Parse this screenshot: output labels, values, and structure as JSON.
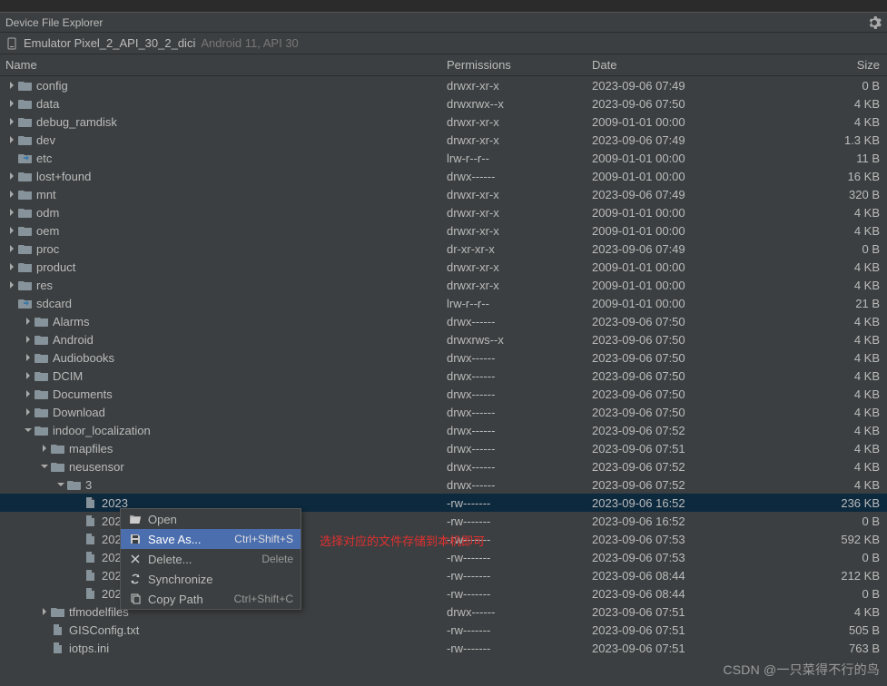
{
  "panel": {
    "title": "Device File Explorer"
  },
  "device": {
    "name": "Emulator Pixel_2_API_30_2_dici",
    "sub": "Android 11, API 30"
  },
  "columns": {
    "name": "Name",
    "perm": "Permissions",
    "date": "Date",
    "size": "Size"
  },
  "rows": [
    {
      "indent": 0,
      "arrow": "r",
      "icon": "folder",
      "name": "config",
      "perm": "drwxr-xr-x",
      "date": "2023-09-06 07:49",
      "size": "0 B"
    },
    {
      "indent": 0,
      "arrow": "r",
      "icon": "folder",
      "name": "data",
      "perm": "drwxrwx--x",
      "date": "2023-09-06 07:50",
      "size": "4 KB"
    },
    {
      "indent": 0,
      "arrow": "r",
      "icon": "folder",
      "name": "debug_ramdisk",
      "perm": "drwxr-xr-x",
      "date": "2009-01-01 00:00",
      "size": "4 KB"
    },
    {
      "indent": 0,
      "arrow": "r",
      "icon": "folder",
      "name": "dev",
      "perm": "drwxr-xr-x",
      "date": "2023-09-06 07:49",
      "size": "1.3 KB"
    },
    {
      "indent": 0,
      "arrow": "",
      "icon": "folder-link",
      "name": "etc",
      "perm": "lrw-r--r--",
      "date": "2009-01-01 00:00",
      "size": "11 B"
    },
    {
      "indent": 0,
      "arrow": "r",
      "icon": "folder",
      "name": "lost+found",
      "perm": "drwx------",
      "date": "2009-01-01 00:00",
      "size": "16 KB"
    },
    {
      "indent": 0,
      "arrow": "r",
      "icon": "folder",
      "name": "mnt",
      "perm": "drwxr-xr-x",
      "date": "2023-09-06 07:49",
      "size": "320 B"
    },
    {
      "indent": 0,
      "arrow": "r",
      "icon": "folder",
      "name": "odm",
      "perm": "drwxr-xr-x",
      "date": "2009-01-01 00:00",
      "size": "4 KB"
    },
    {
      "indent": 0,
      "arrow": "r",
      "icon": "folder",
      "name": "oem",
      "perm": "drwxr-xr-x",
      "date": "2009-01-01 00:00",
      "size": "4 KB"
    },
    {
      "indent": 0,
      "arrow": "r",
      "icon": "folder",
      "name": "proc",
      "perm": "dr-xr-xr-x",
      "date": "2023-09-06 07:49",
      "size": "0 B"
    },
    {
      "indent": 0,
      "arrow": "r",
      "icon": "folder",
      "name": "product",
      "perm": "drwxr-xr-x",
      "date": "2009-01-01 00:00",
      "size": "4 KB"
    },
    {
      "indent": 0,
      "arrow": "r",
      "icon": "folder",
      "name": "res",
      "perm": "drwxr-xr-x",
      "date": "2009-01-01 00:00",
      "size": "4 KB"
    },
    {
      "indent": 0,
      "arrow": "",
      "icon": "folder-link",
      "name": "sdcard",
      "perm": "lrw-r--r--",
      "date": "2009-01-01 00:00",
      "size": "21 B"
    },
    {
      "indent": 1,
      "arrow": "r",
      "icon": "folder",
      "name": "Alarms",
      "perm": "drwx------",
      "date": "2023-09-06 07:50",
      "size": "4 KB"
    },
    {
      "indent": 1,
      "arrow": "r",
      "icon": "folder",
      "name": "Android",
      "perm": "drwxrws--x",
      "date": "2023-09-06 07:50",
      "size": "4 KB"
    },
    {
      "indent": 1,
      "arrow": "r",
      "icon": "folder",
      "name": "Audiobooks",
      "perm": "drwx------",
      "date": "2023-09-06 07:50",
      "size": "4 KB"
    },
    {
      "indent": 1,
      "arrow": "r",
      "icon": "folder",
      "name": "DCIM",
      "perm": "drwx------",
      "date": "2023-09-06 07:50",
      "size": "4 KB"
    },
    {
      "indent": 1,
      "arrow": "r",
      "icon": "folder",
      "name": "Documents",
      "perm": "drwx------",
      "date": "2023-09-06 07:50",
      "size": "4 KB"
    },
    {
      "indent": 1,
      "arrow": "r",
      "icon": "folder",
      "name": "Download",
      "perm": "drwx------",
      "date": "2023-09-06 07:50",
      "size": "4 KB"
    },
    {
      "indent": 1,
      "arrow": "d",
      "icon": "folder",
      "name": "indoor_localization",
      "perm": "drwx------",
      "date": "2023-09-06 07:52",
      "size": "4 KB"
    },
    {
      "indent": 2,
      "arrow": "r",
      "icon": "folder",
      "name": "mapfiles",
      "perm": "drwx------",
      "date": "2023-09-06 07:51",
      "size": "4 KB"
    },
    {
      "indent": 2,
      "arrow": "d",
      "icon": "folder",
      "name": "neusensor",
      "perm": "drwx------",
      "date": "2023-09-06 07:52",
      "size": "4 KB"
    },
    {
      "indent": 3,
      "arrow": "d",
      "icon": "folder",
      "name": "3",
      "perm": "drwx------",
      "date": "2023-09-06 07:52",
      "size": "4 KB"
    },
    {
      "indent": 4,
      "arrow": "",
      "icon": "file",
      "name": "2023",
      "perm": "-rw-------",
      "date": "2023-09-06 16:52",
      "size": "236 KB",
      "selected": true
    },
    {
      "indent": 4,
      "arrow": "",
      "icon": "file",
      "name": "2023",
      "perm": "-rw-------",
      "date": "2023-09-06 16:52",
      "size": "0 B"
    },
    {
      "indent": 4,
      "arrow": "",
      "icon": "file",
      "name": "2023",
      "perm": "-rw-------",
      "date": "2023-09-06 07:53",
      "size": "592 KB"
    },
    {
      "indent": 4,
      "arrow": "",
      "icon": "file",
      "name": "2023",
      "perm": "-rw-------",
      "date": "2023-09-06 07:53",
      "size": "0 B"
    },
    {
      "indent": 4,
      "arrow": "",
      "icon": "file",
      "name": "2023",
      "perm": "-rw-------",
      "date": "2023-09-06 08:44",
      "size": "212 KB"
    },
    {
      "indent": 4,
      "arrow": "",
      "icon": "file",
      "name": "2023",
      "perm": "-rw-------",
      "date": "2023-09-06 08:44",
      "size": "0 B"
    },
    {
      "indent": 2,
      "arrow": "r",
      "icon": "folder",
      "name": "tfmodelfiles",
      "perm": "drwx------",
      "date": "2023-09-06 07:51",
      "size": "4 KB"
    },
    {
      "indent": 2,
      "arrow": "",
      "icon": "file",
      "name": "GISConfig.txt",
      "perm": "-rw-------",
      "date": "2023-09-06 07:51",
      "size": "505 B"
    },
    {
      "indent": 2,
      "arrow": "",
      "icon": "file",
      "name": "iotps.ini",
      "perm": "-rw-------",
      "date": "2023-09-06 07:51",
      "size": "763 B"
    }
  ],
  "menu": {
    "items": [
      {
        "icon": "folder-open",
        "label": "Open",
        "shortcut": ""
      },
      {
        "icon": "save",
        "label": "Save As...",
        "shortcut": "Ctrl+Shift+S",
        "highlighted": true
      },
      {
        "icon": "x",
        "label": "Delete...",
        "shortcut": "Delete"
      },
      {
        "icon": "sync",
        "label": "Synchronize",
        "shortcut": ""
      },
      {
        "icon": "copy",
        "label": "Copy Path",
        "shortcut": "Ctrl+Shift+C"
      }
    ]
  },
  "annotation": "选择对应的文件存储到本机即可",
  "watermark": "CSDN @一只菜得不行的鸟"
}
